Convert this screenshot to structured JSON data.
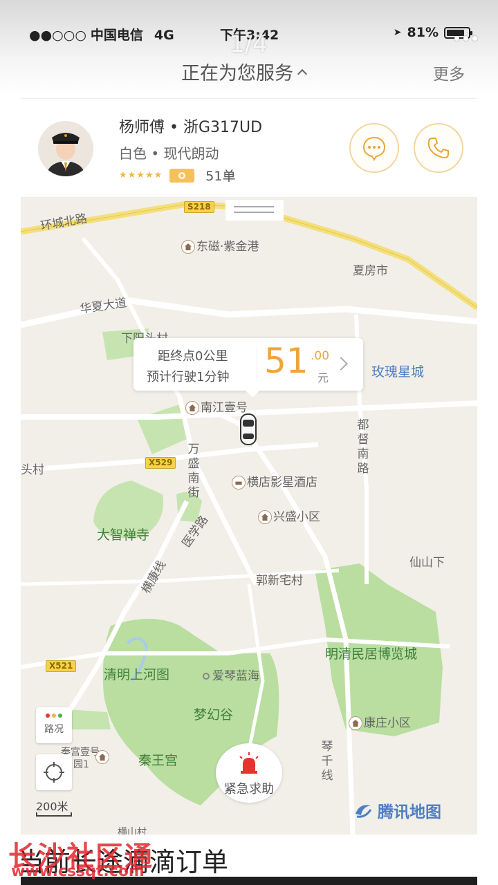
{
  "status_bar": {
    "signal": "●●○○○",
    "carrier": "中国电信",
    "network": "4G",
    "time": "下午3:42",
    "location": "➤",
    "battery": "81%"
  },
  "viewer": {
    "counter": "1/4"
  },
  "header": {
    "title": "正在为您服务",
    "more": "更多"
  },
  "driver": {
    "name_plate": "杨师傅 • 浙G317UD",
    "car": "白色 • 现代朗动",
    "stars": "★★★★★",
    "orders": "51单"
  },
  "trip": {
    "distance": "距终点0公里",
    "duration": "预计行驶1分钟",
    "fare_int": "51",
    "fare_dec": ".00",
    "fare_unit": "元"
  },
  "map": {
    "labels": {
      "huancheng": "环城北路",
      "s218": "S218",
      "dongci": "东磁·紫金港",
      "xiafang": "夏房市",
      "huaxia": "华夏大道",
      "xiamou": "下阳头村",
      "meigui": "玫瑰星城",
      "nanjiang": "南江壹号",
      "x529": "X529",
      "wansheng": "万盛南街",
      "dudu": "都督南路",
      "toucun": "头村",
      "hengdian_hotel": "横店影星酒店",
      "xingsheng": "兴盛小区",
      "dazhi": "大智禅寺",
      "yixue": "医学路",
      "xianshan": "仙山下",
      "hengdian_line": "横康线",
      "guoxin": "郭新宅村",
      "mingqing": "明清民居博览城",
      "x521": "X521",
      "qingming": "清明上河图",
      "aiqin": "爱琴蓝海",
      "menghuan": "梦幻谷",
      "kangzhuang": "康庄小区",
      "qinwang": "秦王宫",
      "qinqian": "琴千线",
      "qinwang_no1": "秦宫壹号",
      "yuan1": "园1",
      "hengshan": "横山村"
    },
    "traffic_label": "路况",
    "scale": "200米",
    "sos": "紧急求助",
    "provider": "腾讯地图"
  },
  "next_screen": {
    "title": "当前长途滴滴订单"
  },
  "watermark": {
    "site": "长沙社区通",
    "url": "www.cssqt.com"
  },
  "colors": {
    "accent": "#f0a43c",
    "park_green": "#b9dea0",
    "road_yellow": "#f3e07c",
    "sos_red": "#e8342f",
    "map_blue": "#4d7fc2"
  }
}
